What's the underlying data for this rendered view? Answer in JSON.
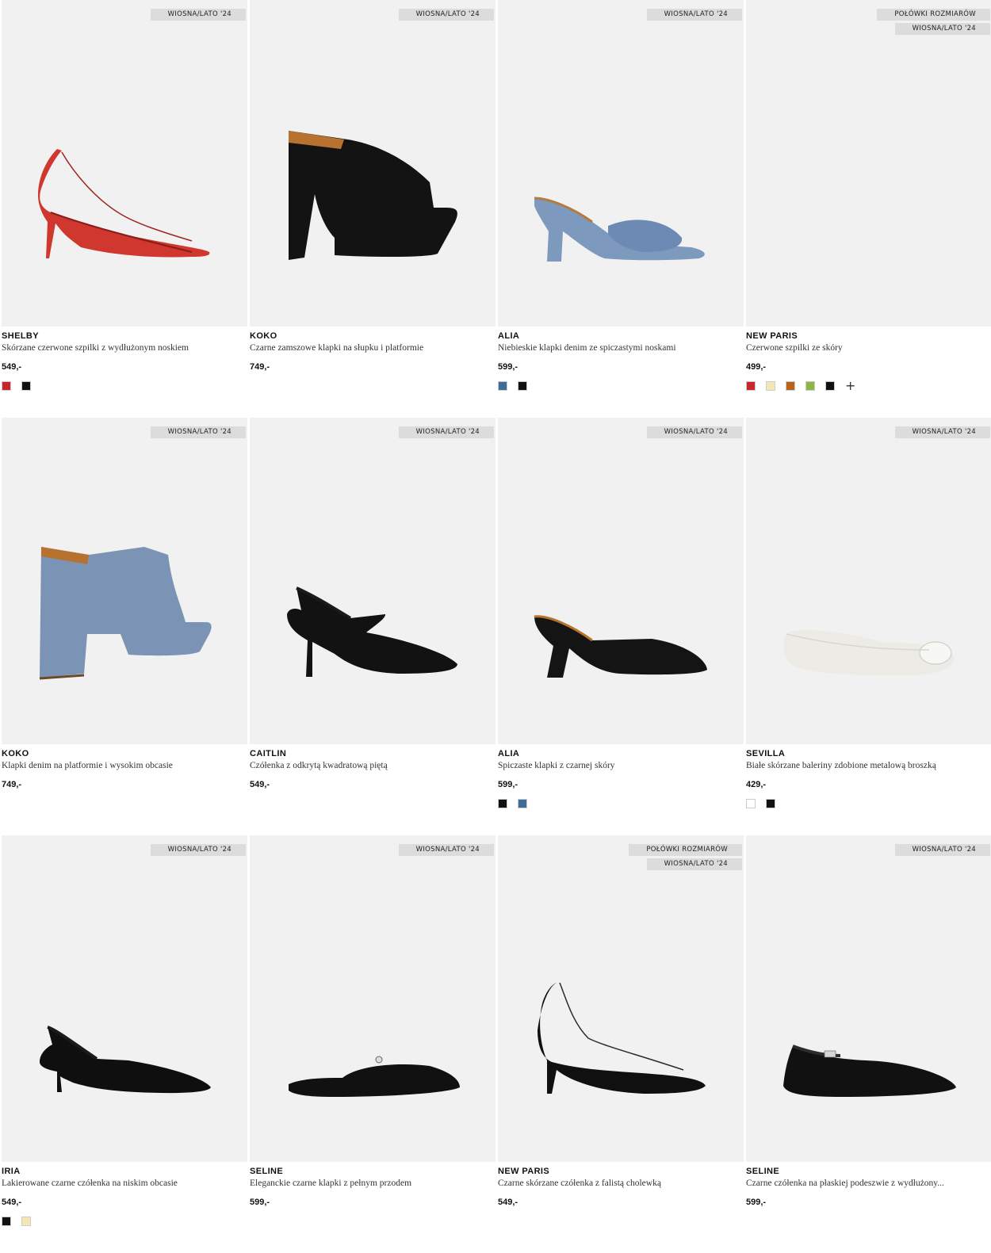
{
  "products": [
    {
      "brand": "SHELBY",
      "description": "Skórzane czerwone szpilki z wydłużonym noskiem",
      "price": "549,-",
      "badges": [
        "WIOSNA/LATO '24"
      ],
      "shoe": "red-pump",
      "swatches": [
        "#c6262c",
        "#111111"
      ],
      "more": false
    },
    {
      "brand": "KOKO",
      "description": "Czarne zamszowe klapki na słupku i platformie",
      "price": "749,-",
      "badges": [
        "WIOSNA/LATO '24"
      ],
      "shoe": "black-platform-mule",
      "swatches": [],
      "more": false
    },
    {
      "brand": "ALIA",
      "description": "Niebieskie klapki denim ze spiczastymi noskami",
      "price": "599,-",
      "badges": [
        "WIOSNA/LATO '24"
      ],
      "shoe": "denim-mule",
      "swatches": [
        "#3f6d97",
        "#111111"
      ],
      "more": false
    },
    {
      "brand": "NEW PARIS",
      "description": "Czerwone szpilki ze skóry",
      "price": "499,-",
      "badges": [
        "POŁÓWKI ROZMIARÓW",
        "WIOSNA/LATO '24"
      ],
      "shoe": "red-pump",
      "swatches": [
        "#c6262c",
        "#f3e7b5",
        "#b8641f",
        "#8fb448",
        "#111111"
      ],
      "more": true
    },
    {
      "brand": "KOKO",
      "description": "Klapki denim na platformie i wysokim obcasie",
      "price": "749,-",
      "badges": [
        "WIOSNA/LATO '24"
      ],
      "shoe": "denim-platform-mule",
      "swatches": [],
      "more": false
    },
    {
      "brand": "CAITLIN",
      "description": "Czółenka z odkrytą kwadratową piętą",
      "price": "549,-",
      "badges": [
        "WIOSNA/LATO '24"
      ],
      "shoe": "black-slingback-strap",
      "swatches": [],
      "more": false
    },
    {
      "brand": "ALIA",
      "description": "Spiczaste klapki z czarnej skóry",
      "price": "599,-",
      "badges": [
        "WIOSNA/LATO '24"
      ],
      "shoe": "black-mule",
      "swatches": [
        "#111111",
        "#3f6d97"
      ],
      "more": false
    },
    {
      "brand": "SEVILLA",
      "description": "Białe skórzane baleriny zdobione metalową broszką",
      "price": "429,-",
      "badges": [
        "WIOSNA/LATO '24"
      ],
      "shoe": "white-ballerina",
      "swatches": [
        "#ffffff",
        "#111111"
      ],
      "more": false
    },
    {
      "brand": "IRIA",
      "description": "Lakierowane czarne czółenka na niskim obcasie",
      "price": "549,-",
      "badges": [
        "WIOSNA/LATO '24"
      ],
      "shoe": "black-kitten-slingback",
      "swatches": [
        "#111111",
        "#f3e7b5"
      ],
      "more": false
    },
    {
      "brand": "SELINE",
      "description": "Eleganckie czarne klapki z pełnym przodem",
      "price": "599,-",
      "badges": [
        "WIOSNA/LATO '24"
      ],
      "shoe": "black-flat-mule",
      "swatches": [],
      "more": false
    },
    {
      "brand": "NEW PARIS",
      "description": "Czarne skórzane czółenka z falistą cholewką",
      "price": "549,-",
      "badges": [
        "POŁÓWKI ROZMIARÓW",
        "WIOSNA/LATO '24"
      ],
      "shoe": "black-pump",
      "swatches": [],
      "more": false
    },
    {
      "brand": "SELINE",
      "description": "Czarne czółenka na płaskiej podeszwie z wydłużony...",
      "price": "599,-",
      "badges": [
        "WIOSNA/LATO '24"
      ],
      "shoe": "black-flat-slingback",
      "swatches": [],
      "more": false
    }
  ],
  "more_colors_symbol": "+"
}
